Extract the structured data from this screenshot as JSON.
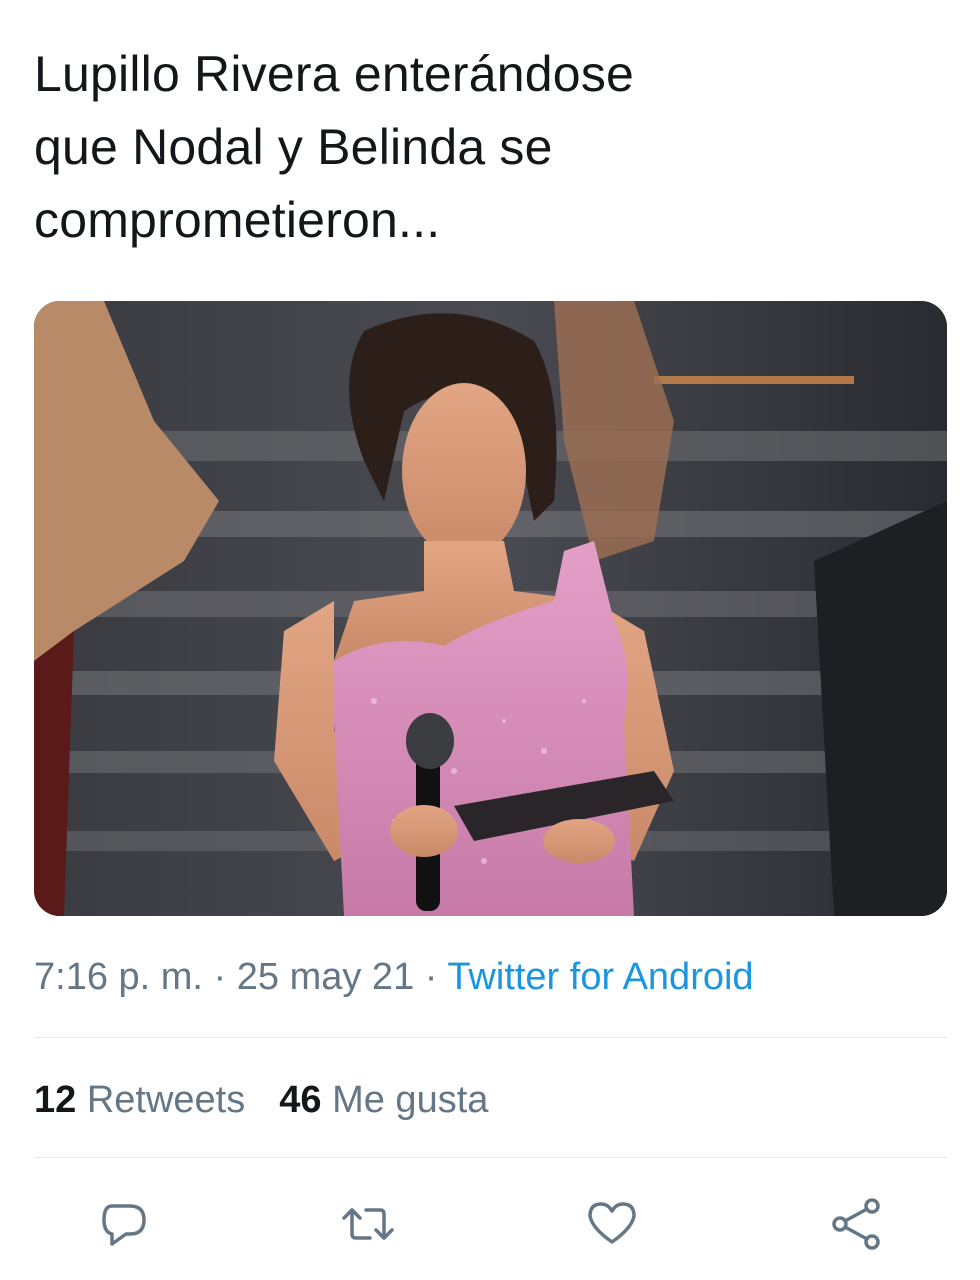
{
  "tweet": {
    "text": "Lupillo Rivera enterándose\nque Nodal y Belinda se\ncomprometieron..."
  },
  "media": {
    "alt": "",
    "dress_color": "#d58ab4"
  },
  "meta": {
    "time": "7:16 p. m.",
    "separator": " · ",
    "date": "25 may 21",
    "source": "Twitter for Android"
  },
  "stats": {
    "retweets_count": "12",
    "retweets_label": " Retweets",
    "likes_count": "46",
    "likes_label": " Me gusta"
  },
  "actions": {
    "reply_icon": "reply-icon",
    "retweet_icon": "retweet-icon",
    "like_icon": "heart-icon",
    "share_icon": "share-icon"
  },
  "colors": {
    "text": "#14171a",
    "secondary": "#657786",
    "link": "#1b95e0",
    "divider": "#e1e8ed"
  }
}
